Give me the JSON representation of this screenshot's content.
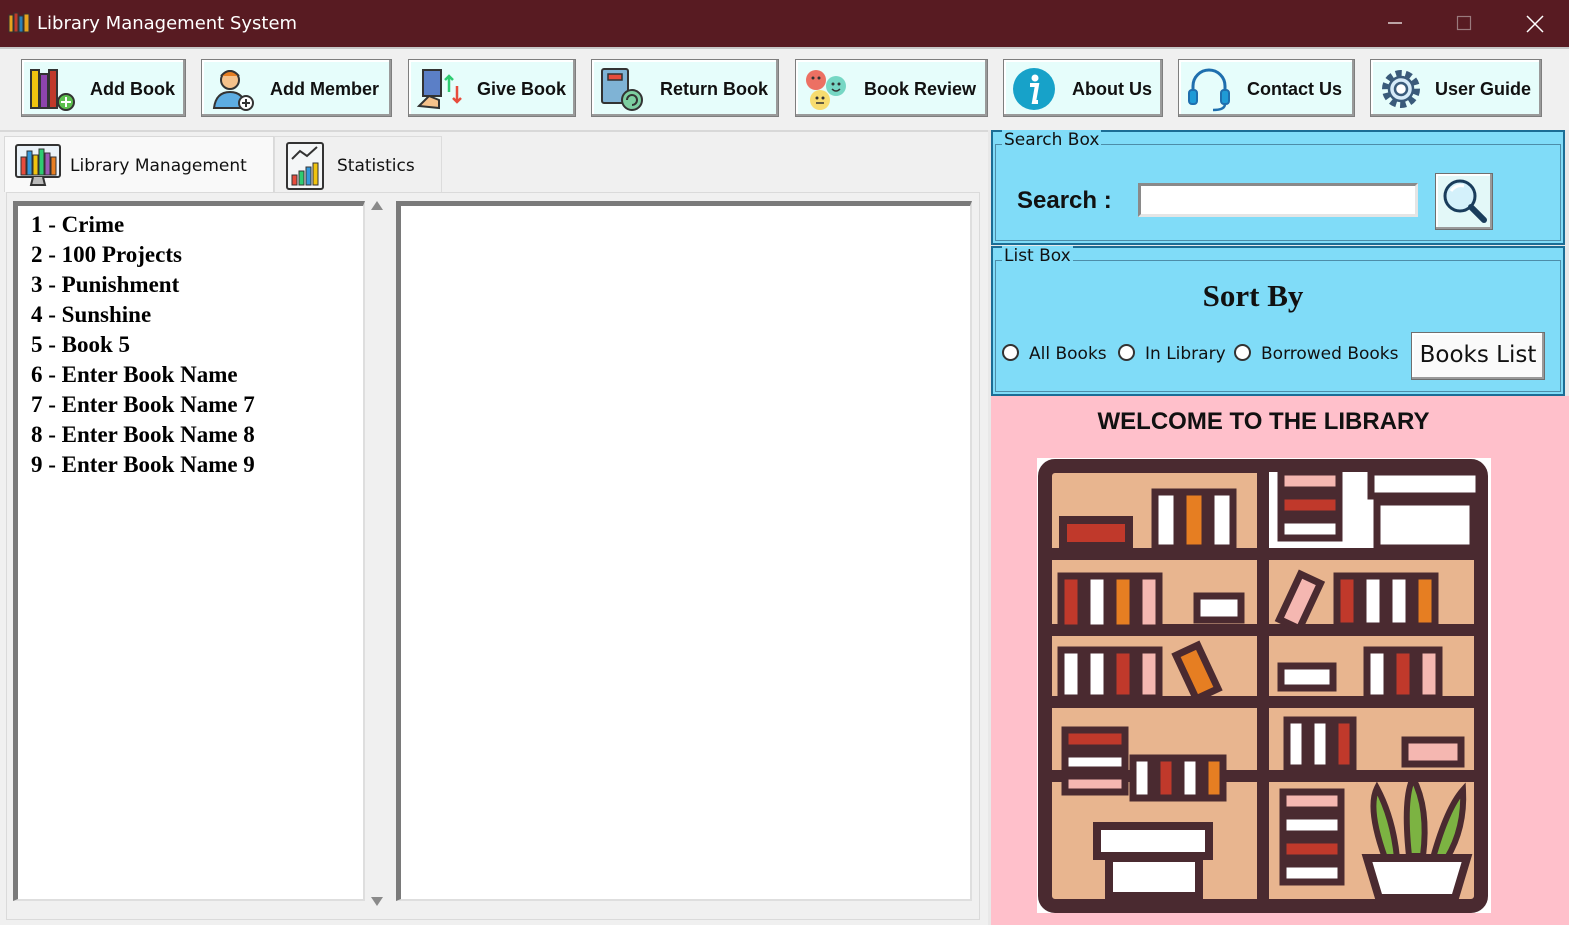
{
  "window": {
    "title": "Library Management System"
  },
  "toolbar": {
    "buttons": [
      {
        "label": "Add Book",
        "icon": "books-add-icon"
      },
      {
        "label": "Add Member",
        "icon": "member-add-icon"
      },
      {
        "label": "Give Book",
        "icon": "give-book-icon"
      },
      {
        "label": "Return Book",
        "icon": "return-book-icon"
      },
      {
        "label": "Book Review",
        "icon": "review-faces-icon"
      },
      {
        "label": "About Us",
        "icon": "info-icon"
      },
      {
        "label": "Contact Us",
        "icon": "headset-icon"
      },
      {
        "label": "User Guide",
        "icon": "gear-icon"
      }
    ]
  },
  "tabs": [
    {
      "label": "Library Management",
      "active": true
    },
    {
      "label": "Statistics",
      "active": false
    }
  ],
  "book_list": {
    "items": [
      "1 - Crime",
      "2 - 100 Projects",
      "3 - Punishment",
      "4 - Sunshine",
      "5 - Book 5",
      "6 - Enter Book Name",
      "7 - Enter Book Name 7",
      "8 - Enter Book Name 8",
      "9 - Enter Book Name 9"
    ]
  },
  "search_box": {
    "group_label": "Search Box",
    "label": "Search :",
    "value": ""
  },
  "list_box": {
    "group_label": "List Box",
    "heading": "Sort By",
    "options": [
      "All Books",
      "In Library",
      "Borrowed Books"
    ],
    "button_label": "Books List"
  },
  "welcome": {
    "heading": "WELCOME TO THE LIBRARY"
  },
  "colors": {
    "titlebar": "#581b22",
    "toolbar_button": "#e6fdfb",
    "panel_blue": "#80dcf8",
    "welcome_pink": "#ffc0cb"
  }
}
